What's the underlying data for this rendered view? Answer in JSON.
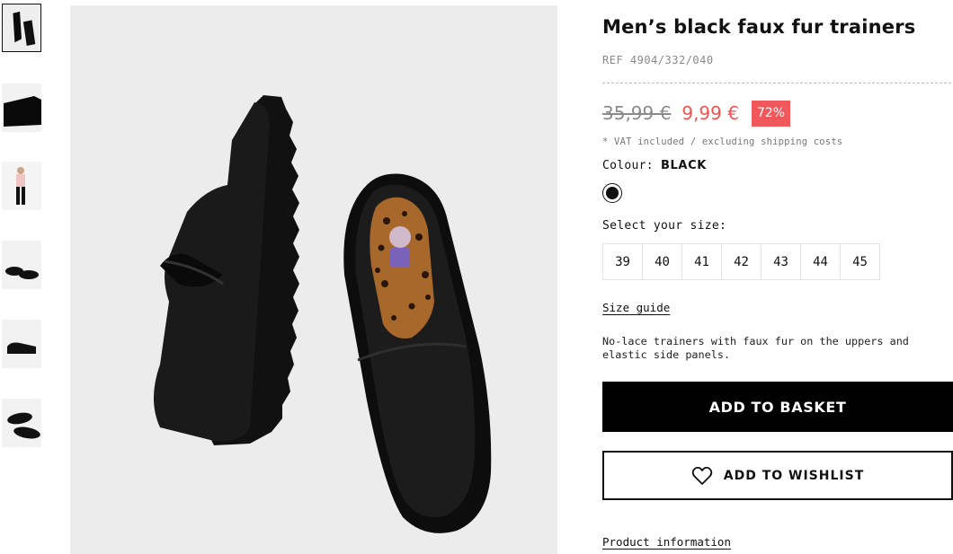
{
  "product": {
    "title": "Men’s black faux fur trainers",
    "ref": "REF 4904/332/040",
    "old_price": "35,99 €",
    "new_price": "9,99 €",
    "discount": "72%",
    "vat_note": "* VAT included / excluding shipping costs",
    "colour_label": "Colour:",
    "colour_value": "BLACK",
    "size_label": "Select your size:",
    "sizes": [
      "39",
      "40",
      "41",
      "42",
      "43",
      "44",
      "45"
    ],
    "size_guide": "Size guide",
    "description": "No-lace trainers with faux fur on the uppers and elastic side panels.",
    "add_to_basket": "ADD TO BASKET",
    "add_to_wishlist": "ADD TO WISHLIST",
    "product_information": "Product information"
  },
  "colors": {
    "sale_red": "#f0524f",
    "discount_bg": "#f0585b",
    "button_black": "#000000"
  },
  "icons": {
    "wishlist": "heart-outline-icon"
  }
}
